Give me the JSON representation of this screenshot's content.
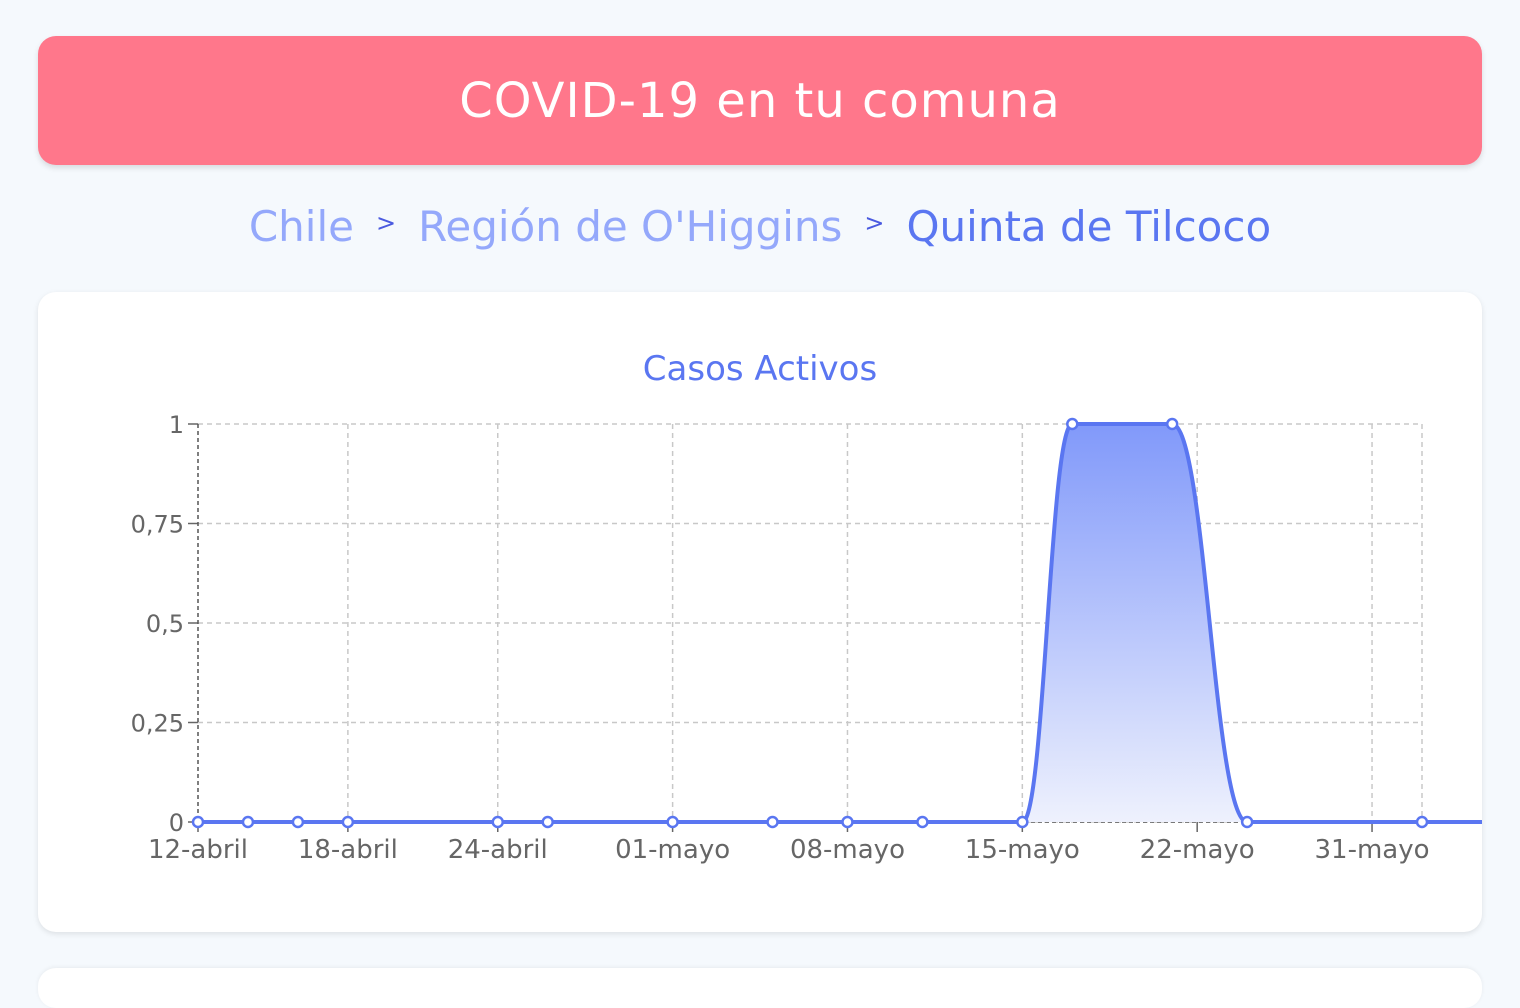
{
  "header": {
    "title": "COVID-19 en tu comuna"
  },
  "breadcrumb": {
    "items": [
      {
        "label": "Chile"
      },
      {
        "label": "Región de O'Higgins"
      },
      {
        "label": "Quinta de Tilcoco"
      }
    ],
    "separator": ">"
  },
  "colors": {
    "header_bg": "#ff778b",
    "line": "#5a76f1",
    "area_top": "#8199fa",
    "crumb_link": "#94a8fb",
    "crumb_current": "#5a76f1"
  },
  "chart_data": {
    "type": "area",
    "title": "Casos Activos",
    "xlabel": "",
    "ylabel": "",
    "x": [
      "12-abril",
      "14-abril",
      "16-abril",
      "18-abril",
      "24-abril",
      "26-abril",
      "01-mayo",
      "05-mayo",
      "08-mayo",
      "11-mayo",
      "15-mayo",
      "17-mayo",
      "21-mayo",
      "24-mayo",
      "31-mayo",
      "03-junio"
    ],
    "x_days": [
      0,
      2,
      4,
      6,
      12,
      14,
      19,
      23,
      26,
      29,
      33,
      35,
      39,
      42,
      49,
      52
    ],
    "series": [
      {
        "values": [
          0,
          0,
          0,
          0,
          0,
          0,
          0,
          0,
          0,
          0,
          0,
          1,
          1,
          0,
          0,
          0
        ]
      }
    ],
    "xticks": [
      "12-abril",
      "18-abril",
      "24-abril",
      "01-mayo",
      "08-mayo",
      "15-mayo",
      "22-mayo",
      "31-mayo"
    ],
    "xtick_days": [
      0,
      6,
      12,
      19,
      26,
      33,
      40,
      47
    ],
    "yticks": [
      "0",
      "0,25",
      "0,5",
      "0,75",
      "1"
    ],
    "ytick_values": [
      0,
      0.25,
      0.5,
      0.75,
      1
    ],
    "ylim": [
      0,
      1
    ],
    "xlim": [
      0,
      49
    ],
    "grid": true,
    "legend": "none"
  }
}
